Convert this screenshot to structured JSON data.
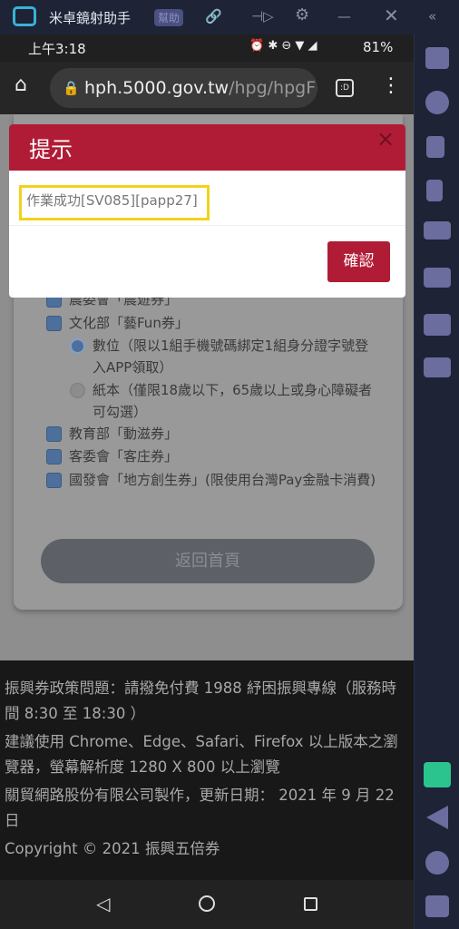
{
  "app": {
    "title": "米卓鏡射助手",
    "help": "幫助"
  },
  "status": {
    "time": "上午3:18",
    "battery": "81%"
  },
  "browser": {
    "url_host": "hph.5000.gov.tw",
    "url_path": "/hpg/hpgF("
  },
  "page": {
    "options": [
      {
        "type": "checkbox",
        "label": "農委會「農遊券」"
      },
      {
        "type": "checkbox",
        "label": "文化部「藝Fun券」"
      },
      {
        "type": "radio",
        "selected": true,
        "label": "數位（限以1組手機號碼綁定1組身分證字號登入APP領取）"
      },
      {
        "type": "radio",
        "selected": false,
        "label": "紙本（僅限18歲以下，65歲以上或身心障礙者可勾選）"
      },
      {
        "type": "checkbox",
        "label": "教育部「動滋券」"
      },
      {
        "type": "checkbox",
        "label": "客委會「客庄券」"
      },
      {
        "type": "checkbox",
        "label": "國發會「地方創生券」(限使用台灣Pay金融卡消費)"
      }
    ],
    "home_button": "返回首頁"
  },
  "footer": {
    "lines": [
      "振興券政策問題：請撥免付費 1988 紓困振興專線（服務時間 8:30 至 18:30 ）",
      "建議使用 Chrome、Edge、Safari、Firefox 以上版本之瀏覽器，螢幕解析度 1280 X 800 以上瀏覽",
      "關貿網路股份有限公司製作，更新日期： 2021 年 9 月 22 日",
      "Copyright © 2021 振興五倍券"
    ]
  },
  "modal": {
    "title": "提示",
    "message": "作業成功[SV085][papp27]",
    "confirm": "確認",
    "close": "×"
  },
  "colors": {
    "accent": "#b01c36",
    "highlight": "#f2d21c"
  }
}
